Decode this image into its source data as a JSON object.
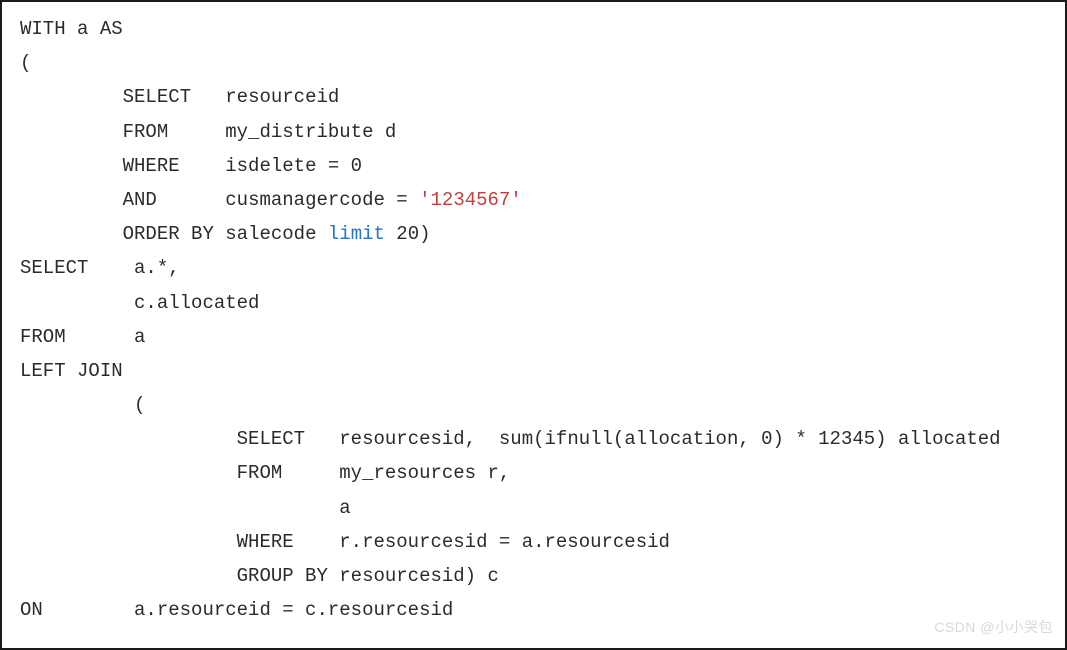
{
  "code": {
    "line1_kw1": "WITH",
    "line1_rest": " a ",
    "line1_kw2": "AS",
    "line2": "(",
    "line3_kw": "SELECT",
    "line3_col": "resourceid",
    "line4_kw": "FROM",
    "line4_tbl": "my_distribute d",
    "line5_kw": "WHERE",
    "line5_cond": "isdelete = 0",
    "line6_kw": "AND",
    "line6_col": "cusmanagercode = ",
    "line6_str": "'1234567'",
    "line7_kw1": "ORDER",
    "line7_kw2": " BY",
    "line7_col": " salecode ",
    "line7_limit": "limit",
    "line7_num": " 20)",
    "line8_kw": "SELECT",
    "line8_col": "a.*,",
    "line9_col": "c.allocated",
    "line10_kw": "FROM",
    "line10_col": "a",
    "line11_kw": "LEFT JOIN",
    "line12": "(",
    "line13_kw": "SELECT",
    "line13_col": "resourcesid,  sum(ifnull(allocation, 0) * 12345) allocated",
    "line14_kw": "FROM",
    "line14_col": "my_resources r,",
    "line15_col": "a",
    "line16_kw": "WHERE",
    "line16_col": "r.resourcesid = a.resourcesid",
    "line17_kw": "GROUP BY",
    "line17_col": " resourcesid) c",
    "line18_kw": "ON",
    "line18_col": "a.resourceid = c.resourcesid"
  },
  "watermark": "CSDN @小小哭包"
}
